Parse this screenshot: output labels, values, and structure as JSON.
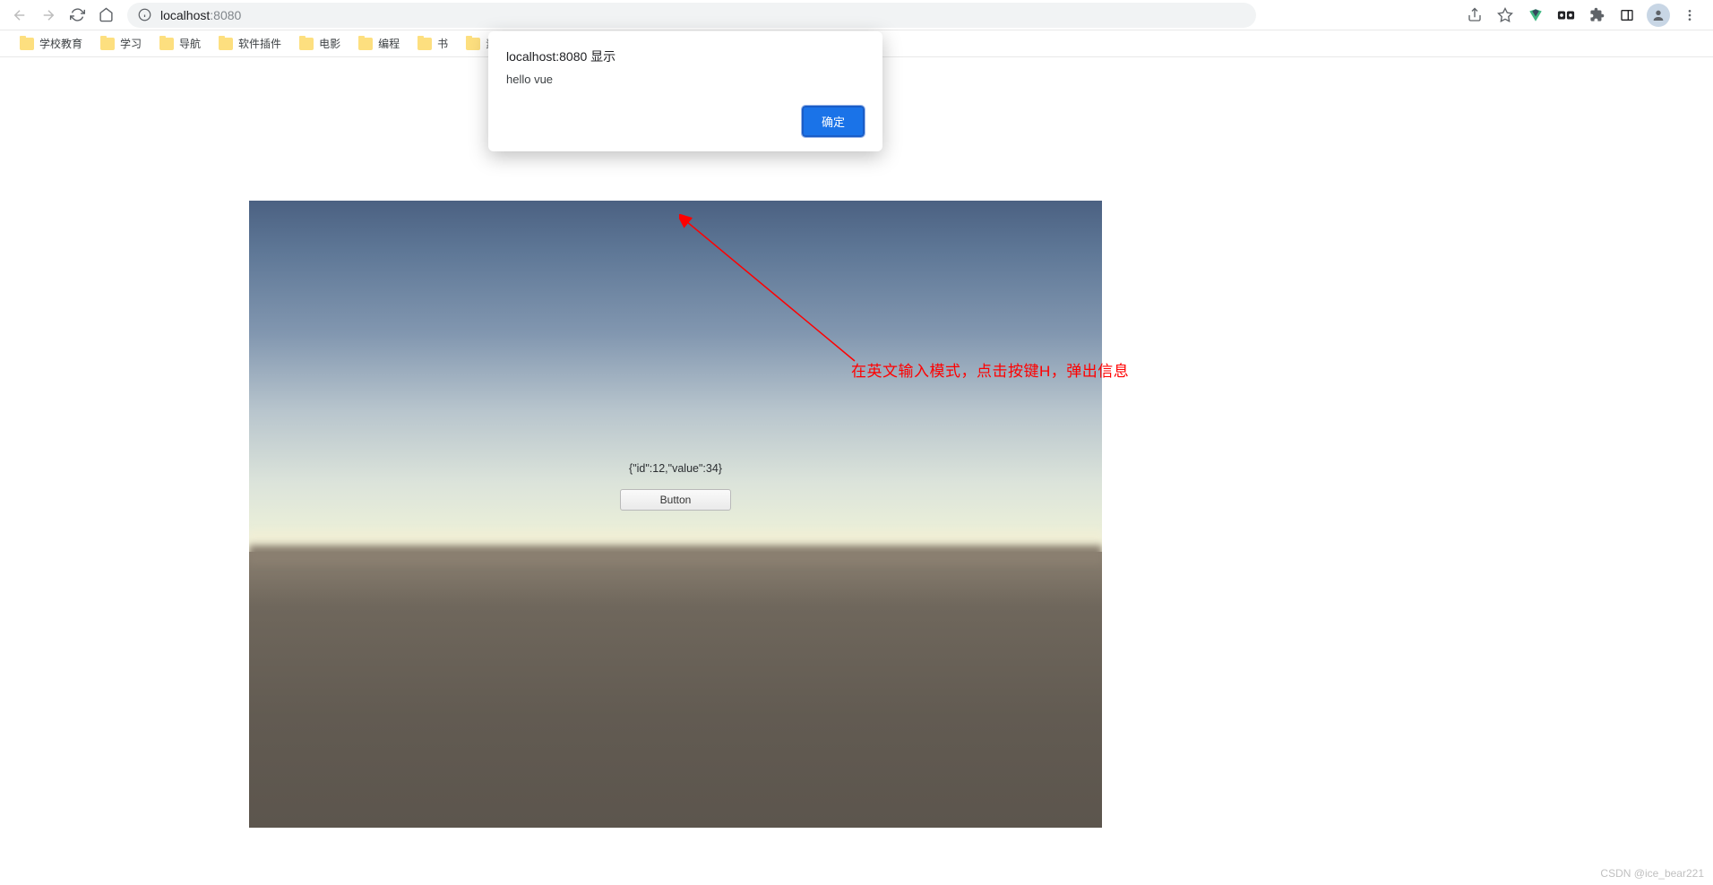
{
  "browser": {
    "url_host": "localhost",
    "url_port": ":8080"
  },
  "bookmarks": [
    {
      "label": "学校教育"
    },
    {
      "label": "学习"
    },
    {
      "label": "导航"
    },
    {
      "label": "软件插件"
    },
    {
      "label": "电影"
    },
    {
      "label": "编程"
    },
    {
      "label": "书"
    },
    {
      "label": "素材"
    }
  ],
  "alert": {
    "title": "localhost:8080 显示",
    "message": "hello vue",
    "ok_label": "确定"
  },
  "unity": {
    "json_text": "{\"id\":12,\"value\":34}",
    "button_label": "Button"
  },
  "annotation": {
    "text": "在英文输入模式，点击按键H，弹出信息"
  },
  "watermark": "CSDN @ice_bear221"
}
